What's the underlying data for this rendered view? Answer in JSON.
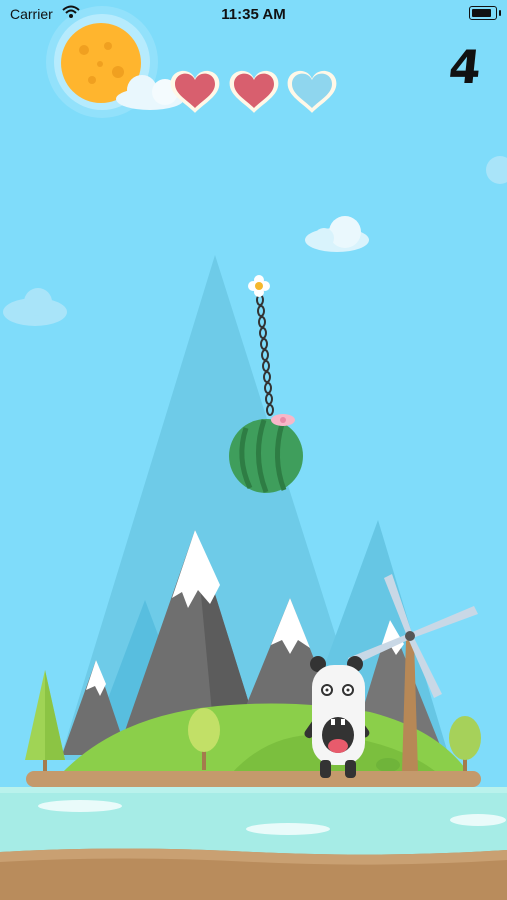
{
  "status_bar": {
    "carrier": "Carrier",
    "time": "11:35 AM",
    "wifi_icon": "wifi-icon",
    "battery_icon": "battery-icon",
    "battery_level": 0.85
  },
  "hud": {
    "score": "4",
    "lives_total": 3,
    "lives_filled": 2,
    "heart_colors": {
      "full": "#d85f6e",
      "empty": "#8fd6ee"
    }
  },
  "scene": {
    "sky_color": "#7fdcfa",
    "sun_color": "#ffb52e",
    "water_color": "#a6ece6",
    "ground_color": "#b98c5c",
    "hill_color": "#8bcf4a",
    "melon_color": "#3f9e5c"
  }
}
